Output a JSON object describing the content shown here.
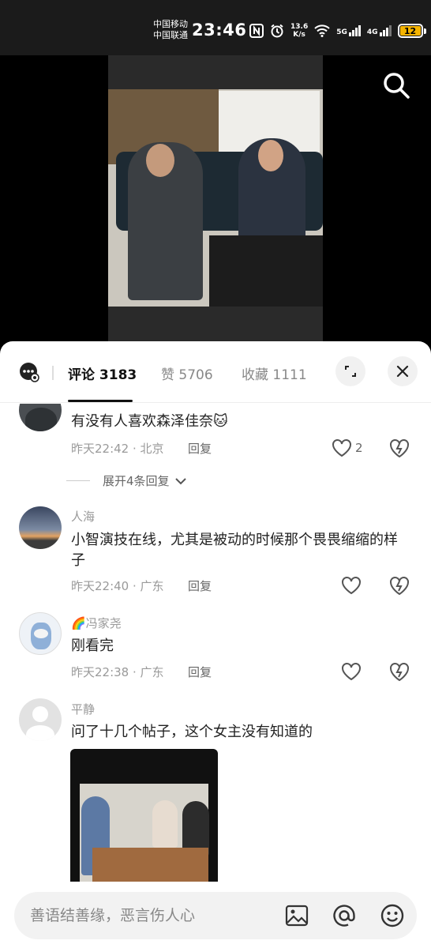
{
  "status_bar": {
    "carrier_1": "中国移动",
    "carrier_2": "中国联通",
    "time": "23:46",
    "net_speed_value": "13.6",
    "net_speed_unit": "K/s",
    "signal_1": "5G",
    "signal_2": "4G",
    "battery": "12",
    "battery_level_percent": 12,
    "battery_color": "#f5b400",
    "icons": [
      "nfc-icon",
      "alarm-icon",
      "wifi-icon",
      "signal-icon",
      "battery-icon"
    ]
  },
  "video": {
    "search_icon": "search-icon"
  },
  "comment_sheet": {
    "tabs": [
      {
        "label": "评论 3183",
        "active": true
      },
      {
        "label": "赞 5706",
        "active": false
      },
      {
        "label": "收藏 1111",
        "active": false
      }
    ],
    "icons": [
      "chat-settings-icon",
      "expand-icon",
      "close-icon"
    ],
    "comments": [
      {
        "username": "",
        "text": "有没有人喜欢森泽佳奈🐱",
        "time": "昨天22:42 · 北京",
        "reply_label": "回复",
        "likes": "2",
        "expand_label": "展开4条回复"
      },
      {
        "username": "人海",
        "text": "小智演技在线，尤其是被动的时候那个畏畏缩缩的样子",
        "time": "昨天22:40 · 广东",
        "reply_label": "回复"
      },
      {
        "username": "🌈冯家尧",
        "text": "刚看完",
        "time": "昨天22:38 · 广东",
        "reply_label": "回复"
      },
      {
        "username": "平静",
        "text": "问了十几个帖子，这个女主没有知道的",
        "has_image": true
      }
    ]
  },
  "input_bar": {
    "placeholder": "善语结善缘，恶言伤人心",
    "icons": [
      "image-icon",
      "at-icon",
      "emoji-icon"
    ]
  },
  "colors": {
    "accent_text": "#111111",
    "muted_text": "#999999",
    "sheet_bg": "#ffffff",
    "battery_low": "#f5b400"
  }
}
